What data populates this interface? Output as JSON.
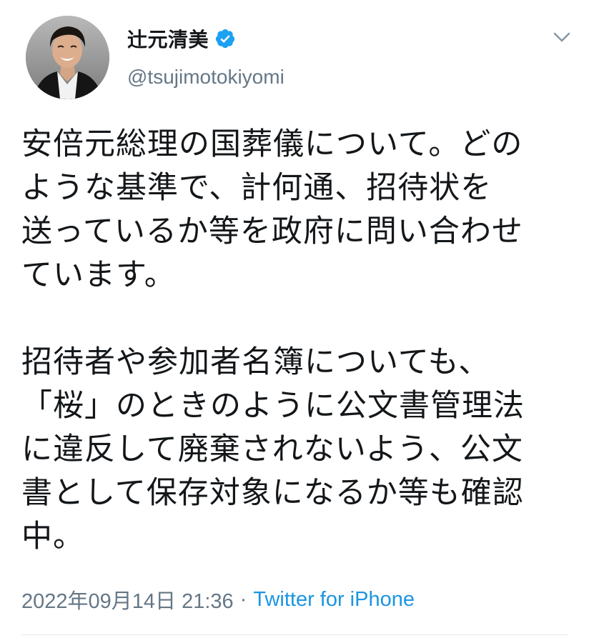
{
  "author": {
    "display_name": "辻元清美",
    "handle": "@tsujimotokiyomi",
    "verified": true,
    "avatar_icon": "profile-photo",
    "verified_color": "#1da1f2"
  },
  "tweet": {
    "paragraphs": [
      "安倍元総理の国葬儀について。どの\nような基準で、計何通、招待状を\n送っているか等を政府に問い合わせ\nています。",
      "招待者や参加者名簿についても、\n「桜」のときのように公文書管理法\nに違反して廃棄されないよう、公文\n書として保存対象になるか等も確認\n中。"
    ],
    "timestamp": "2022年09月14日 21:36",
    "separator": "·",
    "source": "Twitter for iPhone"
  },
  "colors": {
    "text": "#14171a",
    "secondary": "#657786",
    "link": "#1b95e0",
    "divider": "#e6ecf0"
  },
  "icons": {
    "menu": "chevron-down-icon",
    "verified": "verified-badge-icon"
  }
}
